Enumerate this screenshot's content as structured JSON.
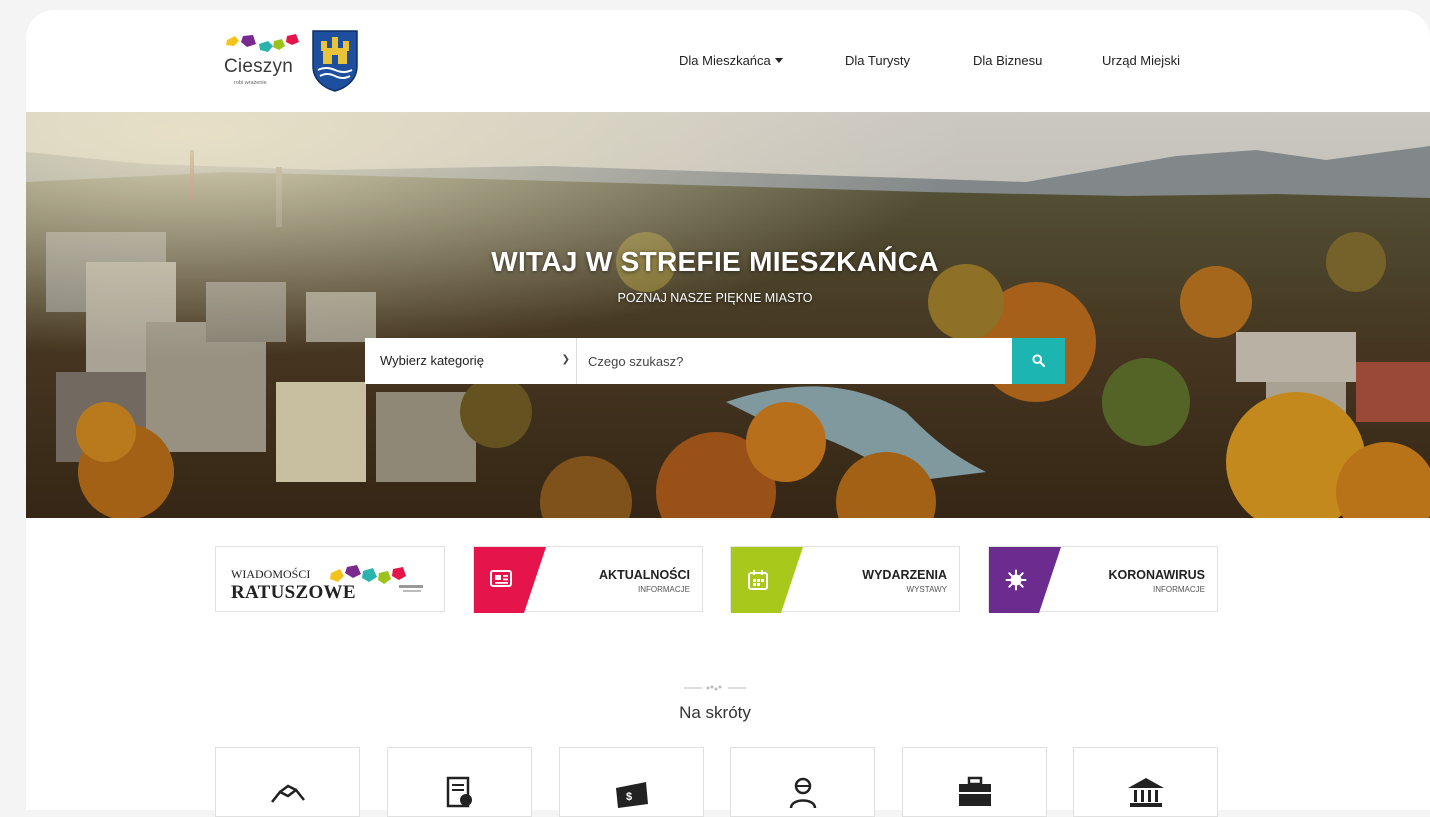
{
  "header": {
    "logo_word": "Cieszyn",
    "logo_tagline": "robi wrażenie",
    "nav": [
      {
        "label": "Dla Mieszkańca",
        "has_dropdown": true
      },
      {
        "label": "Dla Turysty"
      },
      {
        "label": "Dla Biznesu"
      },
      {
        "label": "Urząd Miejski"
      }
    ]
  },
  "hero": {
    "title": "WITAJ W STREFIE MIESZKAŃCA",
    "subtitle": "POZNAJ NASZE PIĘKNE MIASTO",
    "search": {
      "category_value": "Wybierz kategorię",
      "query_placeholder": "Czego szukasz?",
      "button_icon": "search-icon"
    }
  },
  "quick_links": [
    {
      "type": "logo",
      "line1": "WIADOMOŚCI",
      "line2": "RATUSZOWE"
    },
    {
      "title": "AKTUALNOŚCI",
      "subtitle": "INFORMACJE",
      "color": "#e5144a",
      "icon": "newspaper-icon"
    },
    {
      "title": "WYDARZENIA",
      "subtitle": "WYSTAWY",
      "color": "#a8c91c",
      "icon": "calendar-icon"
    },
    {
      "title": "KORONAWIRUS",
      "subtitle": "INFORMACJE",
      "color": "#6c2b8e",
      "icon": "virus-icon"
    }
  ],
  "shortcuts": {
    "title": "Na skróty",
    "items": [
      {
        "icon": "handshake-icon"
      },
      {
        "icon": "document-icon"
      },
      {
        "icon": "money-icon"
      },
      {
        "icon": "person-icon"
      },
      {
        "icon": "briefcase-icon"
      },
      {
        "icon": "city-hall-icon"
      }
    ]
  },
  "colors": {
    "accent": "#1cb5b0",
    "news": "#e5144a",
    "events": "#a8c91c",
    "covid": "#6c2b8e"
  }
}
